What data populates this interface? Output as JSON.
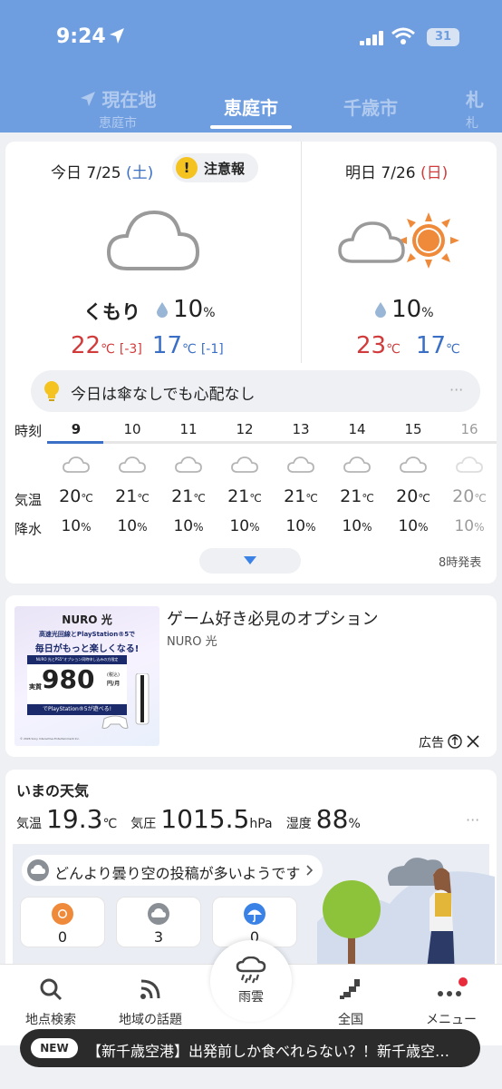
{
  "status_bar": {
    "time": "9:24",
    "battery": "31"
  },
  "location_tabs": [
    {
      "label": "現在地",
      "sub": "恵庭市"
    },
    {
      "label": "恵庭市",
      "sub": ""
    },
    {
      "label": "千歳市",
      "sub": ""
    },
    {
      "label": "札",
      "sub": "札"
    }
  ],
  "today": {
    "prefix": "今日 7/25 ",
    "dow": "(土)",
    "warning": "注意報",
    "condition": "くもり",
    "precip_num": "10",
    "precip_unit": "%",
    "high": "22",
    "high_unit": "℃",
    "high_diff": "[-3]",
    "low": "17",
    "low_unit": "℃",
    "low_diff": "[-1]"
  },
  "tomorrow": {
    "prefix": "明日 7/26 ",
    "dow": "(日)",
    "precip_num": "10",
    "precip_unit": "%",
    "high": "23",
    "high_unit": "℃",
    "low": "17",
    "low_unit": "℃"
  },
  "tip": {
    "text": "今日は傘なしでも心配なし",
    "more": "···"
  },
  "hourly": {
    "label_time": "時刻",
    "label_temp": "気温",
    "label_rain": "降水",
    "hours": [
      "9",
      "10",
      "11",
      "12",
      "13",
      "14",
      "15",
      "16"
    ],
    "temps": [
      "20",
      "21",
      "21",
      "21",
      "21",
      "21",
      "20",
      "20"
    ],
    "temp_unit": "℃",
    "rain": [
      "10",
      "10",
      "10",
      "10",
      "10",
      "10",
      "10",
      "10"
    ],
    "rain_unit": "%",
    "issued": "8時発表"
  },
  "ad": {
    "headline": "ゲーム好き必見のオプション",
    "sponsor": "NURO 光",
    "label": "広告",
    "image": {
      "brand": "NURO 光",
      "line1": "高速光回線とPlayStation®5で",
      "line2": "毎日がもっと楽しくなる!",
      "note": "NURO 光とPS5°オプション同時申し込みの方限定",
      "prefix": "実質",
      "price": "980",
      "tax": "(税込)",
      "per": "円/月",
      "line3": "でPlayStation®5が遊べる!",
      "copyright": "© 2026 Sony Interactive Entertainment Inc."
    }
  },
  "current": {
    "title": "いまの天気",
    "temp_label": "気温",
    "temp": "19.3",
    "temp_unit": "℃",
    "pressure_label": "気圧",
    "pressure": "1015.5",
    "pressure_unit": "hPa",
    "humidity_label": "湿度",
    "humidity": "88",
    "humidity_unit": "%",
    "more": "···",
    "post_text": "どんより曇り空の投稿が多いようです",
    "counts": [
      "0",
      "3",
      "0"
    ]
  },
  "nav": {
    "search": "地点検索",
    "topics": "地域の話題",
    "rain": "雨雲",
    "national": "全国",
    "menu": "メニュー"
  },
  "ticker": {
    "badge": "NEW",
    "text": "【新千歳空港】出発前しか食べれらない？！新千歳空…"
  },
  "colors": {
    "header": "#6f9ee0",
    "high": "#d23b3b",
    "low": "#3b6fc5",
    "warning": "#f4c31f",
    "sun": "#ef8a3a"
  }
}
